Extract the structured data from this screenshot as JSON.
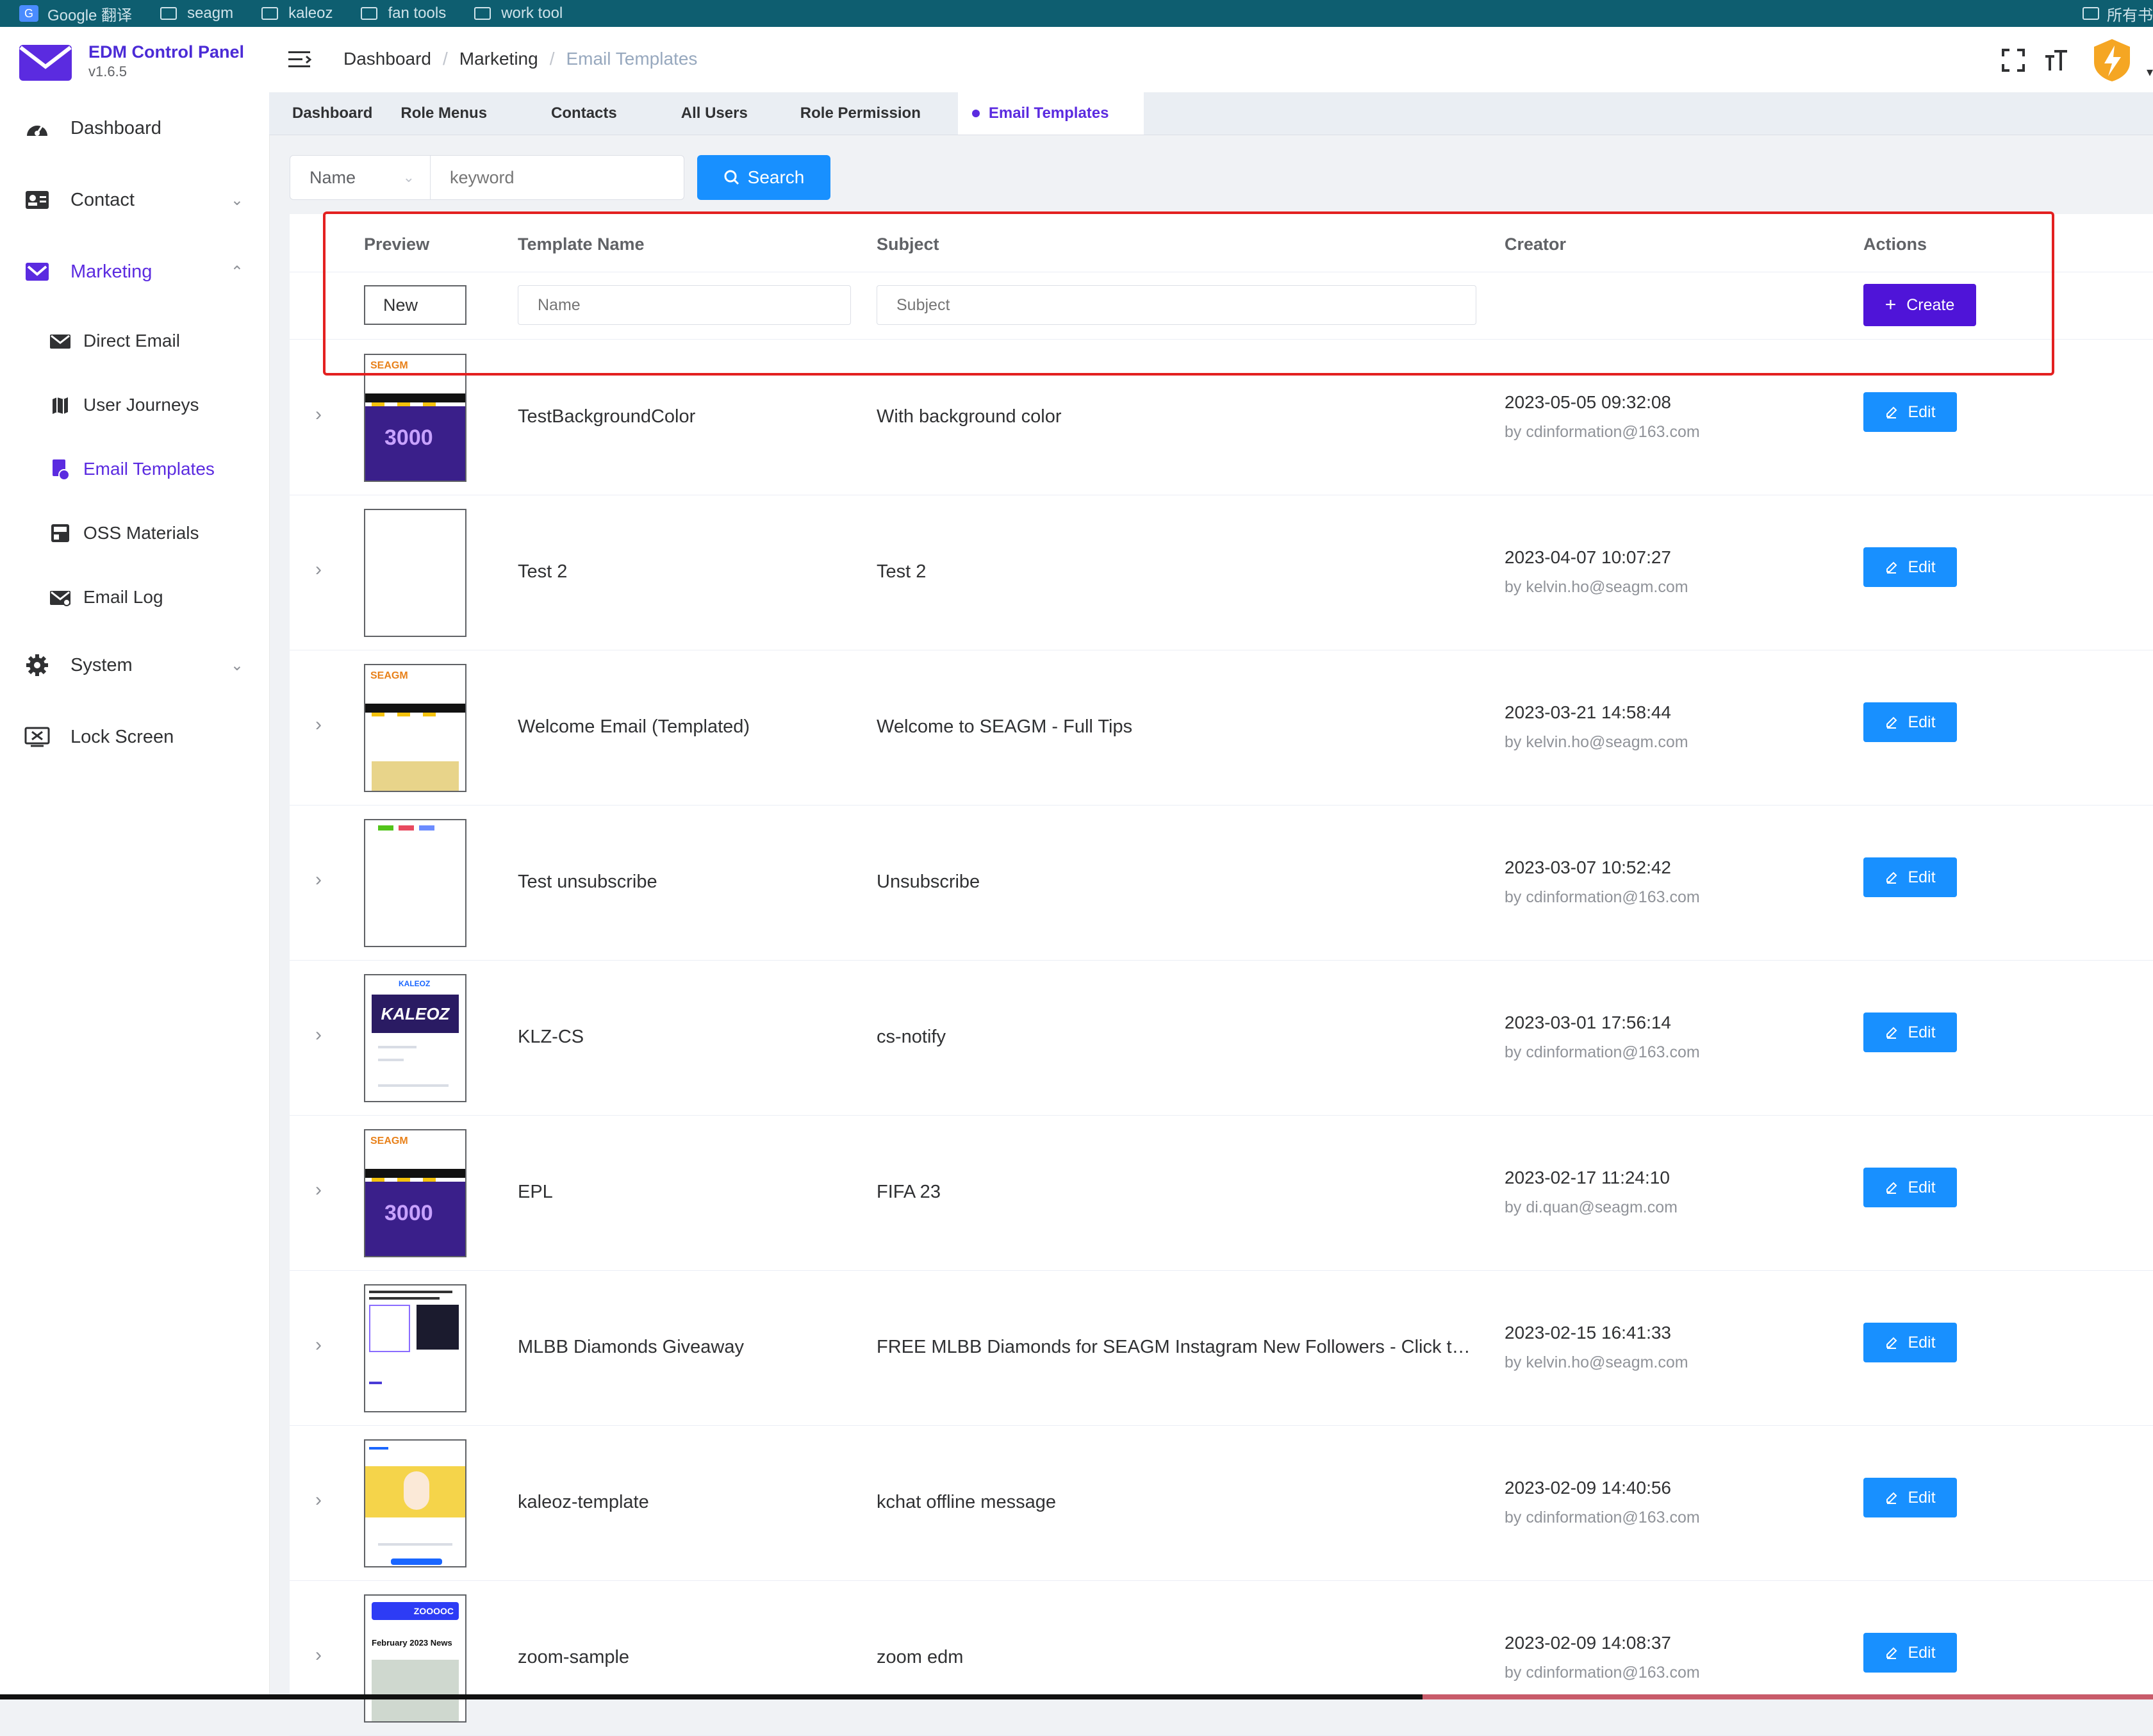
{
  "bookmarks": [
    "Google 翻译",
    "seagm",
    "kaleoz",
    "fan tools",
    "work tool"
  ],
  "bookmarks_right": "所有书",
  "app": {
    "title": "EDM Control Panel",
    "version": "v1.6.5",
    "accent": "#5b2be0"
  },
  "sidebar": {
    "items": [
      {
        "label": "Dashboard",
        "icon": "dashboard-icon"
      },
      {
        "label": "Contact",
        "icon": "contact-card-icon",
        "chevron": "⌄"
      },
      {
        "label": "Marketing",
        "icon": "mail-icon",
        "chevron": "⌃"
      },
      {
        "label": "System",
        "icon": "gear-icon",
        "chevron": "⌄"
      },
      {
        "label": "Lock Screen",
        "icon": "lock-screen-icon"
      }
    ],
    "subitems": [
      {
        "label": "Direct Email",
        "icon": "envelope-icon"
      },
      {
        "label": "User Journeys",
        "icon": "map-icon"
      },
      {
        "label": "Email Templates",
        "icon": "template-icon"
      },
      {
        "label": "OSS Materials",
        "icon": "materials-icon"
      },
      {
        "label": "Email Log",
        "icon": "email-log-icon"
      }
    ]
  },
  "breadcrumb": [
    "Dashboard",
    "Marketing",
    "Email Templates"
  ],
  "breadcrumb_sep": "/",
  "tabs": [
    "Dashboard",
    "Role Menus",
    "Contacts",
    "All Users",
    "Role Permission",
    "Email Templates"
  ],
  "search": {
    "field": "Name",
    "placeholder": "keyword",
    "button": "Search"
  },
  "table": {
    "headers": {
      "preview": "Preview",
      "name": "Template Name",
      "subject": "Subject",
      "creator": "Creator",
      "actions": "Actions"
    },
    "new_row": {
      "preview_label": "New",
      "name_placeholder": "Name",
      "subject_placeholder": "Subject",
      "create_label": "Create"
    },
    "edit_label": "Edit",
    "rows": [
      {
        "name": "TestBackgroundColor",
        "subject": "With background color",
        "date": "2023-05-05 09:32:08",
        "by": "by cdinformation@163.com",
        "thumb": "seagm"
      },
      {
        "name": "Test 2",
        "subject": "Test 2",
        "date": "2023-04-07 10:07:27",
        "by": "by kelvin.ho@seagm.com",
        "thumb": "blank"
      },
      {
        "name": "Welcome Email (Templated)",
        "subject": "Welcome to SEAGM - Full Tips",
        "date": "2023-03-21 14:58:44",
        "by": "by kelvin.ho@seagm.com",
        "thumb": "welcome"
      },
      {
        "name": "Test unsubscribe",
        "subject": "Unsubscribe",
        "date": "2023-03-07 10:52:42",
        "by": "by cdinformation@163.com",
        "thumb": "unsub"
      },
      {
        "name": "KLZ-CS",
        "subject": "cs-notify",
        "date": "2023-03-01 17:56:14",
        "by": "by cdinformation@163.com",
        "thumb": "kaleoz"
      },
      {
        "name": "EPL",
        "subject": "FIFA 23",
        "date": "2023-02-17 11:24:10",
        "by": "by di.quan@seagm.com",
        "thumb": "seagm2"
      },
      {
        "name": "MLBB Diamonds Giveaway",
        "subject": "FREE MLBB Diamonds for SEAGM Instagram New Followers - Click to r...",
        "date": "2023-02-15 16:41:33",
        "by": "by kelvin.ho@seagm.com",
        "thumb": "mlbb"
      },
      {
        "name": "kaleoz-template",
        "subject": "kchat offline message",
        "date": "2023-02-09 14:40:56",
        "by": "by cdinformation@163.com",
        "thumb": "kchat"
      },
      {
        "name": "zoom-sample",
        "subject": "zoom edm",
        "date": "2023-02-09 14:08:37",
        "by": "by cdinformation@163.com",
        "thumb": "zoom"
      }
    ]
  },
  "thumb_text": {
    "seagm_logo": "SEAGM",
    "seagm_big": "3000",
    "kaleoz_small": "KALEOZ",
    "kaleoz_hero": "KALEOZ",
    "zoom_bar": "ZOOOOC",
    "zoom_text": "February 2023 News"
  }
}
